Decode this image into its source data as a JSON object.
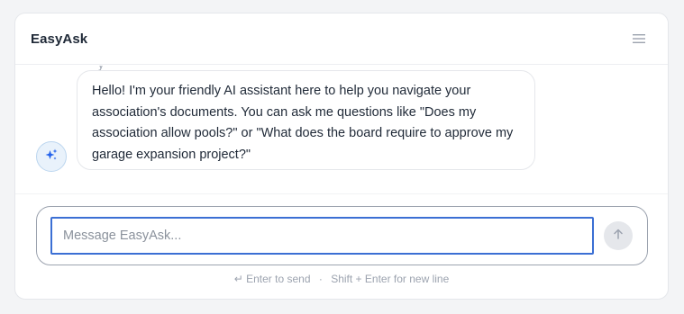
{
  "header": {
    "title": "EasyAsk",
    "menu_icon": "hamburger-menu-icon"
  },
  "messages": {
    "previous_cut_text": "y",
    "assistant_avatar_icon": "sparkle-icon",
    "assistant_message": "Hello! I'm your friendly AI assistant here to help you navigate your association's documents. You can ask me questions like \"Does my association allow pools?\" or \"What does the board require to approve my garage expansion project?\""
  },
  "composer": {
    "placeholder": "Message EasyAsk...",
    "value": "",
    "send_icon": "arrow-up-icon"
  },
  "hint": {
    "enter_icon": "↵",
    "enter_text": "Enter to send",
    "separator": "·",
    "shift_text": "Shift + Enter for new line"
  },
  "colors": {
    "input_focus_border": "#3b6fd4",
    "avatar_background": "#e9f2fb",
    "avatar_icon": "#2563eb",
    "send_button_background": "#e5e7eb"
  }
}
